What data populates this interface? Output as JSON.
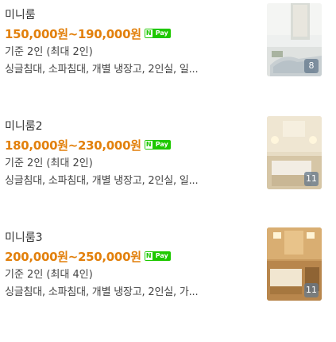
{
  "rooms": [
    {
      "name": "미니룸",
      "price": "150,000원~190,000원",
      "capacity": "기준 2인 (최대 2인)",
      "description": "싱글침대, 소파침대, 개별 냉장고, 2인실, 일...",
      "payment_badge": {
        "n": "N",
        "label": "Pay"
      },
      "photo_count": "8"
    },
    {
      "name": "미니룸2",
      "price": "180,000원~230,000원",
      "capacity": "기준 2인 (최대 2인)",
      "description": "싱글침대, 소파침대, 개별 냉장고, 2인실, 일...",
      "payment_badge": {
        "n": "N",
        "label": "Pay"
      },
      "photo_count": "11"
    },
    {
      "name": "미니룸3",
      "price": "200,000원~250,000원",
      "capacity": "기준 2인 (최대 4인)",
      "description": "싱글침대, 소파침대, 개별 냉장고, 2인실, 가...",
      "payment_badge": {
        "n": "N",
        "label": "Pay"
      },
      "photo_count": "11"
    }
  ],
  "colors": {
    "price": "#e2800c",
    "naver_pay": "#1ec800",
    "text": "#333333"
  }
}
